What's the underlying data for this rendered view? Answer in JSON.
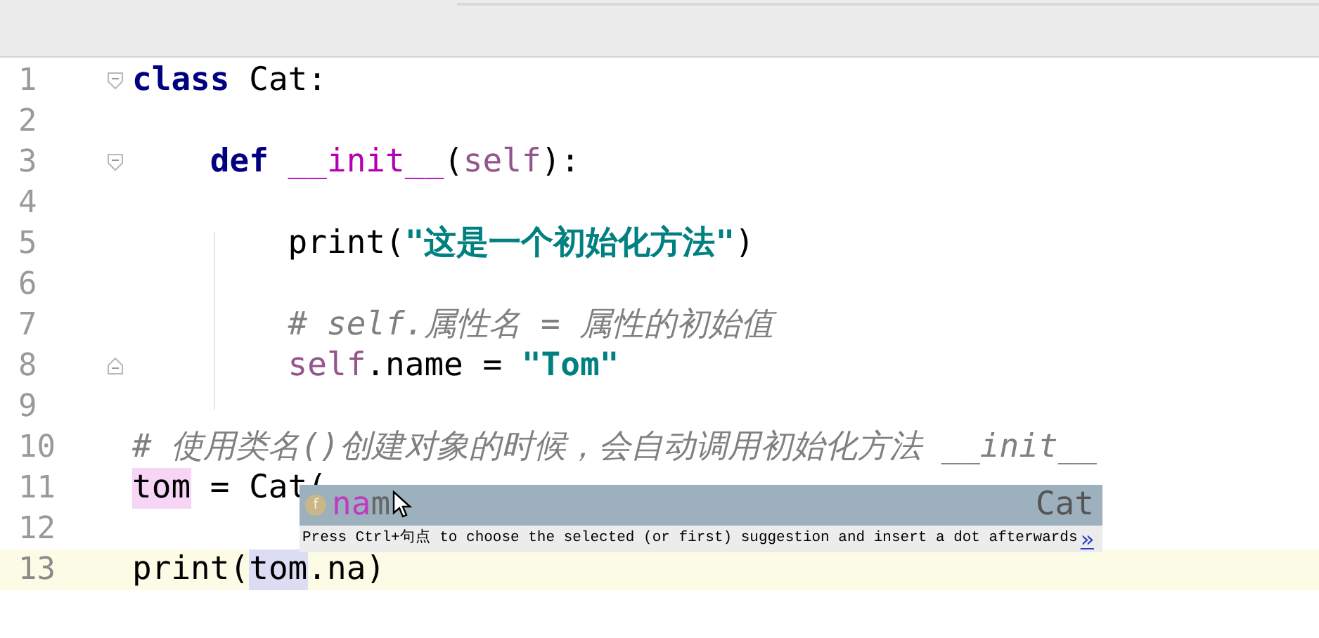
{
  "lines": [
    {
      "number": "1",
      "current": false,
      "fold_start": true,
      "tokens": [
        {
          "kind": "keyword",
          "text": "class"
        },
        {
          "kind": "plain",
          "text": " Cat:"
        }
      ]
    },
    {
      "number": "2",
      "current": false
    },
    {
      "number": "3",
      "current": false,
      "fold_start": true,
      "tokens": [
        {
          "kind": "keyword",
          "text": "    def"
        },
        {
          "kind": "dunder",
          "text": " __init__"
        },
        {
          "kind": "plain",
          "text": "("
        },
        {
          "kind": "self",
          "text": "self"
        },
        {
          "kind": "plain",
          "text": "):"
        }
      ]
    },
    {
      "number": "4",
      "current": false
    },
    {
      "number": "5",
      "current": false,
      "tokens": [
        {
          "kind": "plain",
          "text": "        print("
        },
        {
          "kind": "string",
          "text": "\"这是一个初始化方法\""
        },
        {
          "kind": "plain",
          "text": ")"
        }
      ]
    },
    {
      "number": "6",
      "current": false
    },
    {
      "number": "7",
      "current": false,
      "tokens": [
        {
          "kind": "comment",
          "text": "        # self.属性名 = 属性的初始值"
        }
      ]
    },
    {
      "number": "8",
      "current": false,
      "fold_end": true,
      "tokens": [
        {
          "kind": "self",
          "text": "        self"
        },
        {
          "kind": "plain",
          "text": ".name = "
        },
        {
          "kind": "string",
          "text": "\"Tom\""
        }
      ]
    },
    {
      "number": "9",
      "current": false
    },
    {
      "number": "10",
      "current": false,
      "tokens": [
        {
          "kind": "comment",
          "text": "# 使用类名()创建对象的时候，会自动调用初始化方法 __init__"
        }
      ]
    },
    {
      "number": "11",
      "current": false,
      "tokens": [
        {
          "kind": "write-highlight",
          "text": "tom"
        },
        {
          "kind": "plain",
          "text": " = Cat("
        }
      ]
    },
    {
      "number": "12",
      "current": false
    },
    {
      "number": "13",
      "current": true,
      "tokens": [
        {
          "kind": "plain",
          "text": "print("
        },
        {
          "kind": "read-highlight",
          "text": "tom"
        },
        {
          "kind": "plain",
          "text": ".na)"
        }
      ]
    }
  ],
  "completion": {
    "items": [
      {
        "kind": "field",
        "icon": "f",
        "match": "na",
        "rest": "m",
        "type": "Cat",
        "selected": true
      }
    ],
    "hint": "Press Ctrl+句点 to choose the selected (or first) suggestion and insert a dot afterwards",
    "hint_link": "»"
  }
}
